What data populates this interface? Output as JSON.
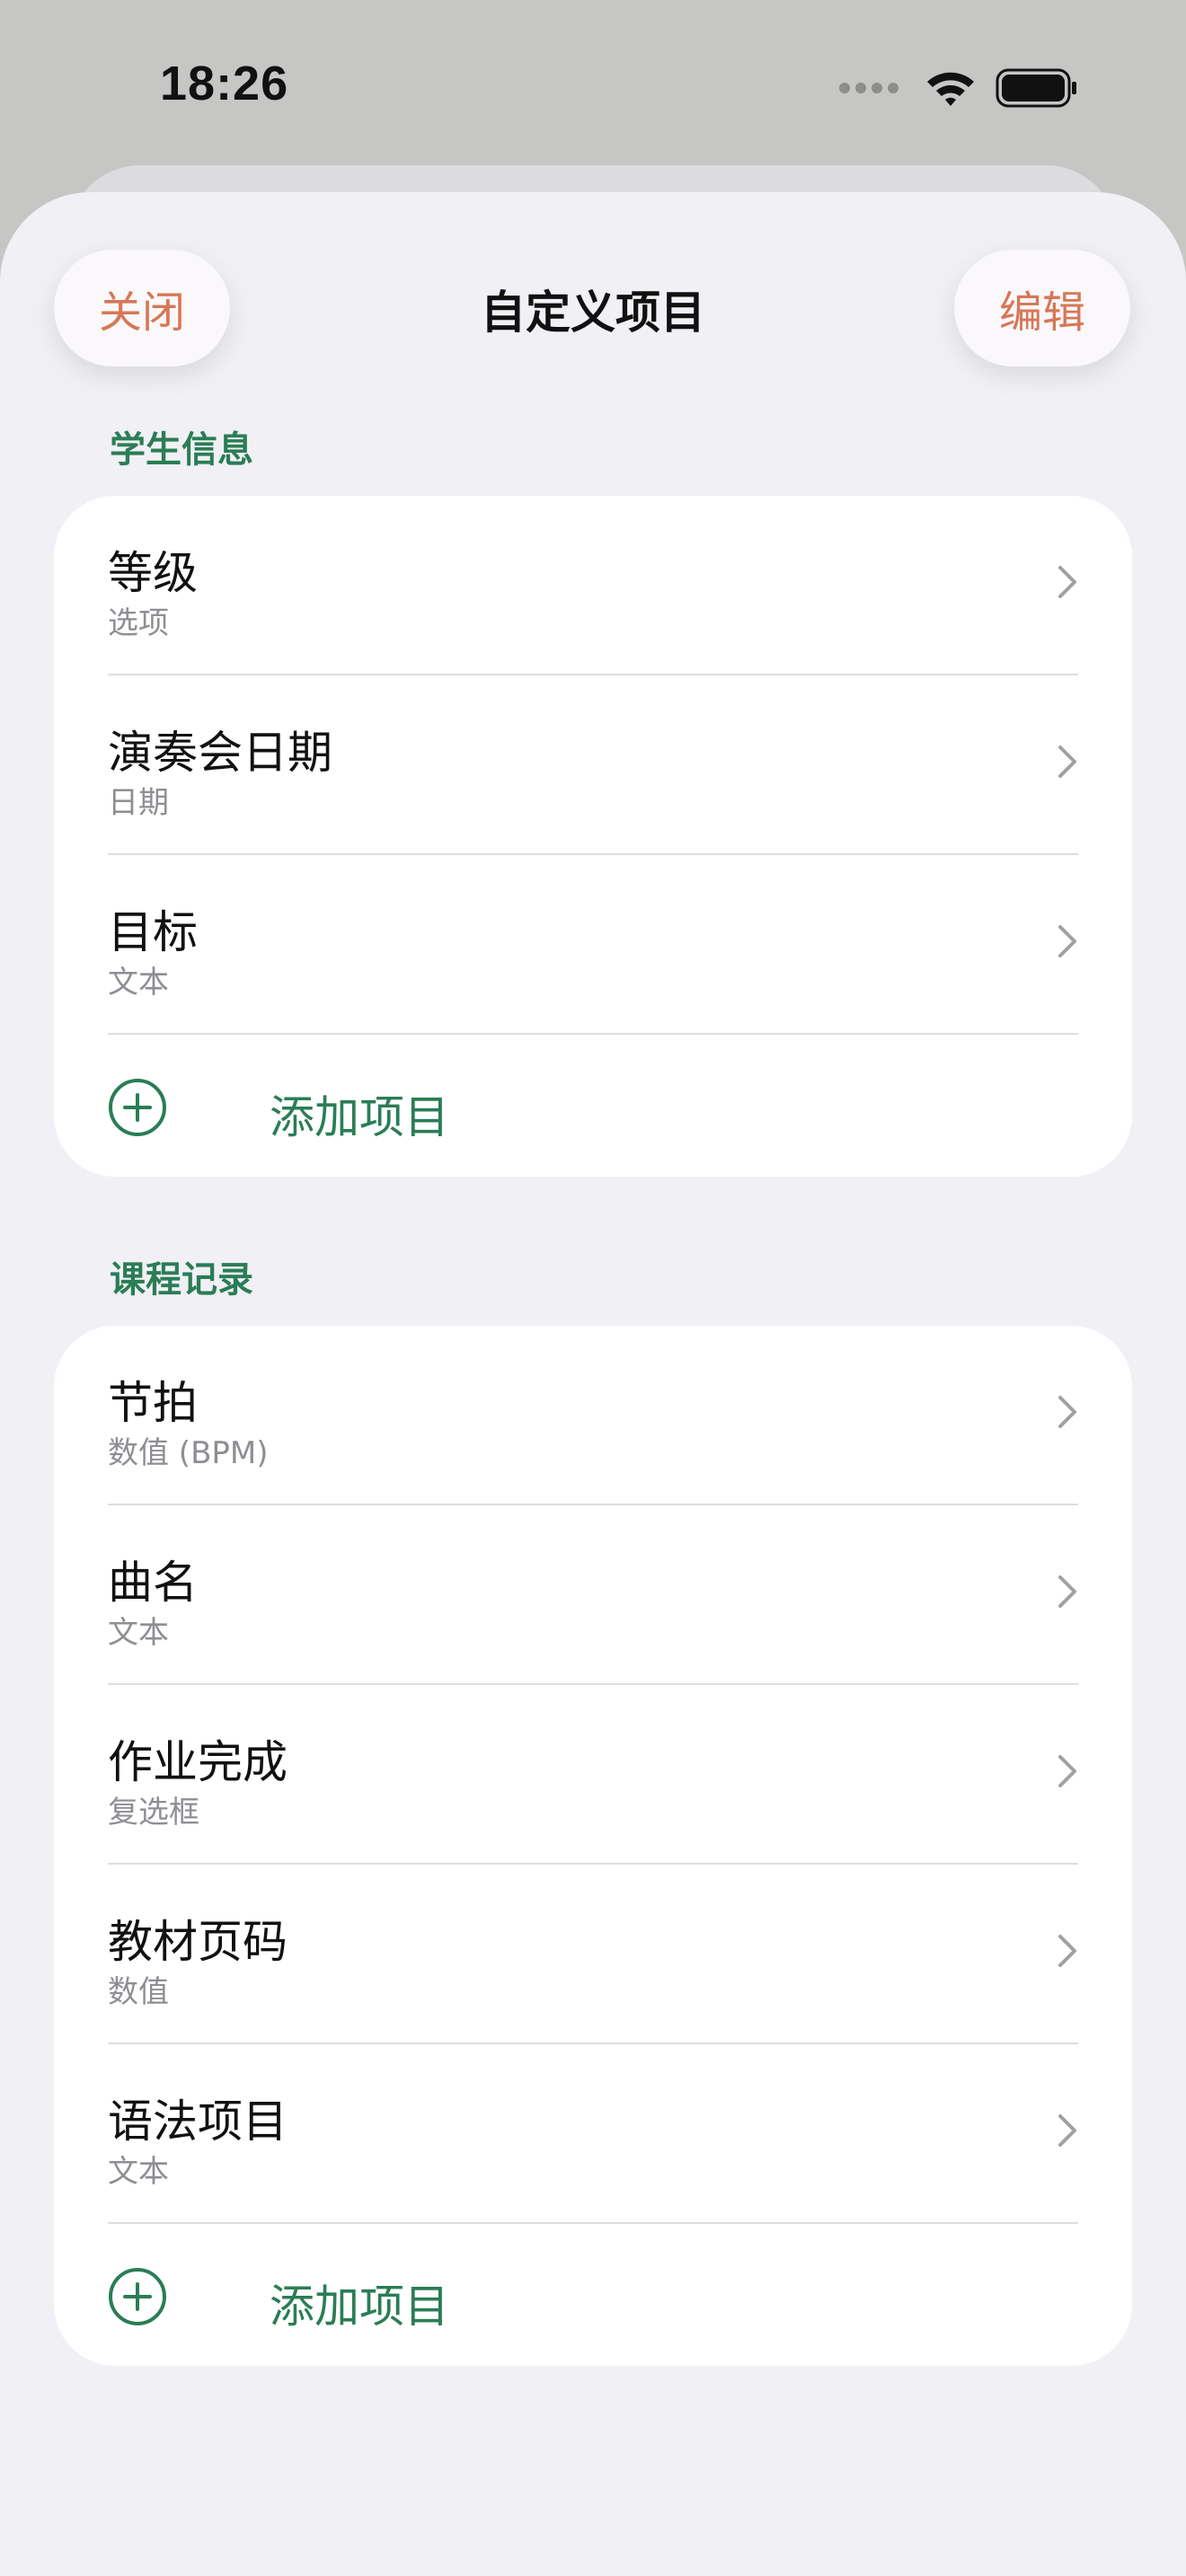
{
  "status_bar": {
    "time": "18:26",
    "icons": [
      "cellular-signal-icon",
      "wifi-icon",
      "battery-icon"
    ]
  },
  "header": {
    "close_label": "关闭",
    "title": "自定义项目",
    "edit_label": "编辑"
  },
  "colors": {
    "accent_green": "#2a7d55",
    "button_orange": "#d77757"
  },
  "sections": [
    {
      "header": "学生信息",
      "items": [
        {
          "title": "等级",
          "type": "选项"
        },
        {
          "title": "演奏会日期",
          "type": "日期"
        },
        {
          "title": "目标",
          "type": "文本"
        }
      ],
      "add_label": "添加项目"
    },
    {
      "header": "课程记录",
      "items": [
        {
          "title": "节拍",
          "type": "数值 (BPM)"
        },
        {
          "title": "曲名",
          "type": "文本"
        },
        {
          "title": "作业完成",
          "type": "复选框"
        },
        {
          "title": "教材页码",
          "type": "数值"
        },
        {
          "title": "语法项目",
          "type": "文本"
        }
      ],
      "add_label": "添加项目"
    }
  ]
}
